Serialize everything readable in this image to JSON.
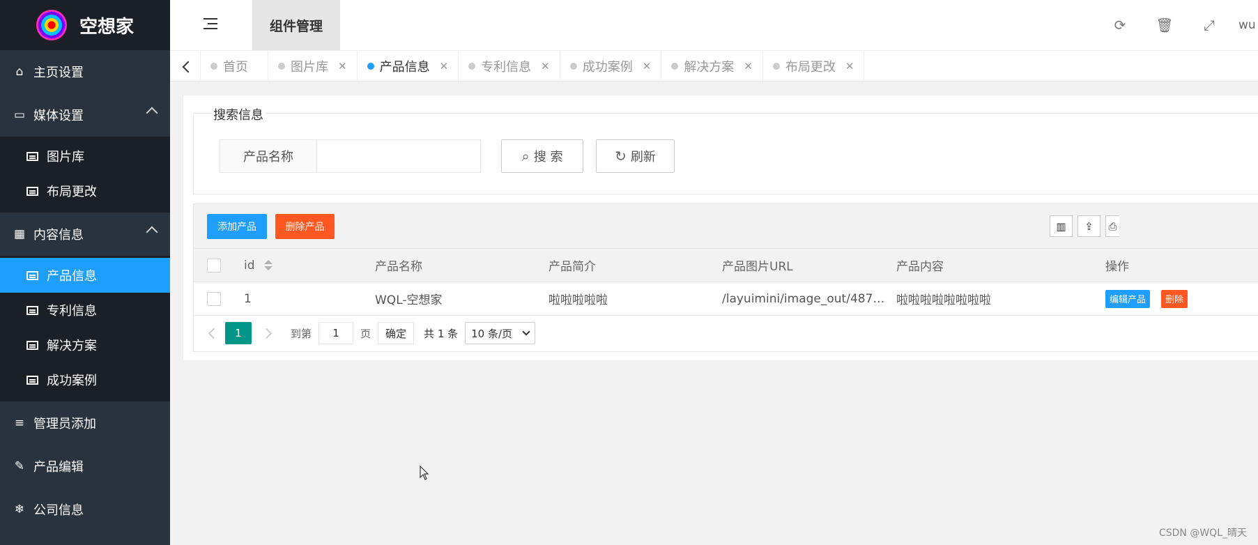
{
  "app": {
    "logo_text": "空想家"
  },
  "sidebar": {
    "items": [
      {
        "label": "主页设置",
        "icon": "home-icon"
      },
      {
        "label": "媒体设置",
        "icon": "window-icon",
        "expanded": true,
        "children": [
          {
            "label": "图片库"
          },
          {
            "label": "布局更改"
          }
        ]
      },
      {
        "label": "内容信息",
        "icon": "calendar-icon",
        "expanded": true,
        "children": [
          {
            "label": "产品信息",
            "active": true
          },
          {
            "label": "专利信息"
          },
          {
            "label": "解决方案"
          },
          {
            "label": "成功案例"
          }
        ]
      },
      {
        "label": "管理员添加",
        "icon": "bars-icon"
      },
      {
        "label": "产品编辑",
        "icon": "edit-icon"
      },
      {
        "label": "公司信息",
        "icon": "snowflake-icon"
      }
    ]
  },
  "header": {
    "tab_label": "组件管理",
    "user": "wu"
  },
  "tabs": [
    {
      "label": "首页",
      "closable": false
    },
    {
      "label": "图片库",
      "closable": true
    },
    {
      "label": "产品信息",
      "closable": true,
      "active": true
    },
    {
      "label": "专利信息",
      "closable": true
    },
    {
      "label": "成功案例",
      "closable": true
    },
    {
      "label": "解决方案",
      "closable": true
    },
    {
      "label": "布局更改",
      "closable": true
    }
  ],
  "search": {
    "legend": "搜索信息",
    "field_label": "产品名称",
    "value": "",
    "search_button": "搜 索",
    "refresh_button": "刷新"
  },
  "table": {
    "add_button": "添加产品",
    "delete_button": "删除产品",
    "columns": [
      "id",
      "产品名称",
      "产品简介",
      "产品图片URL",
      "产品内容",
      "操作"
    ],
    "rows": [
      {
        "id": "1",
        "name": "WQL-空想家",
        "desc": "啦啦啦啦啦",
        "url": "/layuimini/image_out/487…",
        "content": "啦啦啦啦啦啦啦啦",
        "edit": "编辑产品",
        "delete": "删除"
      }
    ]
  },
  "pager": {
    "current": "1",
    "goto_label": "到第",
    "goto_value": "1",
    "page_unit": "页",
    "confirm": "确定",
    "count": "共 1 条",
    "limit": "10 条/页"
  },
  "watermark": "CSDN @WQL_晴天",
  "colors": {
    "accent": "#1e9fff",
    "danger": "#ff5722",
    "sidebar": "#28333e",
    "pager": "#009688"
  }
}
